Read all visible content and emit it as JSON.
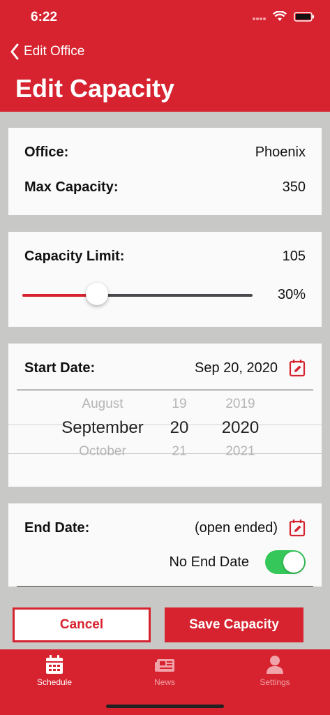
{
  "status": {
    "time": "6:22"
  },
  "nav": {
    "back_label": "Edit Office",
    "title": "Edit Capacity"
  },
  "office": {
    "label": "Office:",
    "value": "Phoenix",
    "max_label": "Max Capacity:",
    "max_value": "350"
  },
  "capacity": {
    "label": "Capacity Limit:",
    "value": "105",
    "percent_label": "30%",
    "slider_fraction": 0.3
  },
  "start": {
    "label": "Start Date:",
    "value": "Sep 20, 2020",
    "picker": {
      "months": [
        "August",
        "September",
        "October"
      ],
      "days": [
        "19",
        "20",
        "21"
      ],
      "years": [
        "2019",
        "2020",
        "2021"
      ]
    }
  },
  "end": {
    "label": "End Date:",
    "value": "(open ended)",
    "no_end_label": "No End Date",
    "no_end_on": true
  },
  "actions": {
    "cancel": "Cancel",
    "save": "Save Capacity"
  },
  "tabs": [
    {
      "label": "Schedule",
      "icon": "calendar-icon",
      "active": true
    },
    {
      "label": "News",
      "icon": "newspaper-icon",
      "active": false
    },
    {
      "label": "Settings",
      "icon": "user-icon",
      "active": false
    }
  ],
  "colors": {
    "brand": "#d6232f",
    "toggle_on": "#35c759"
  }
}
